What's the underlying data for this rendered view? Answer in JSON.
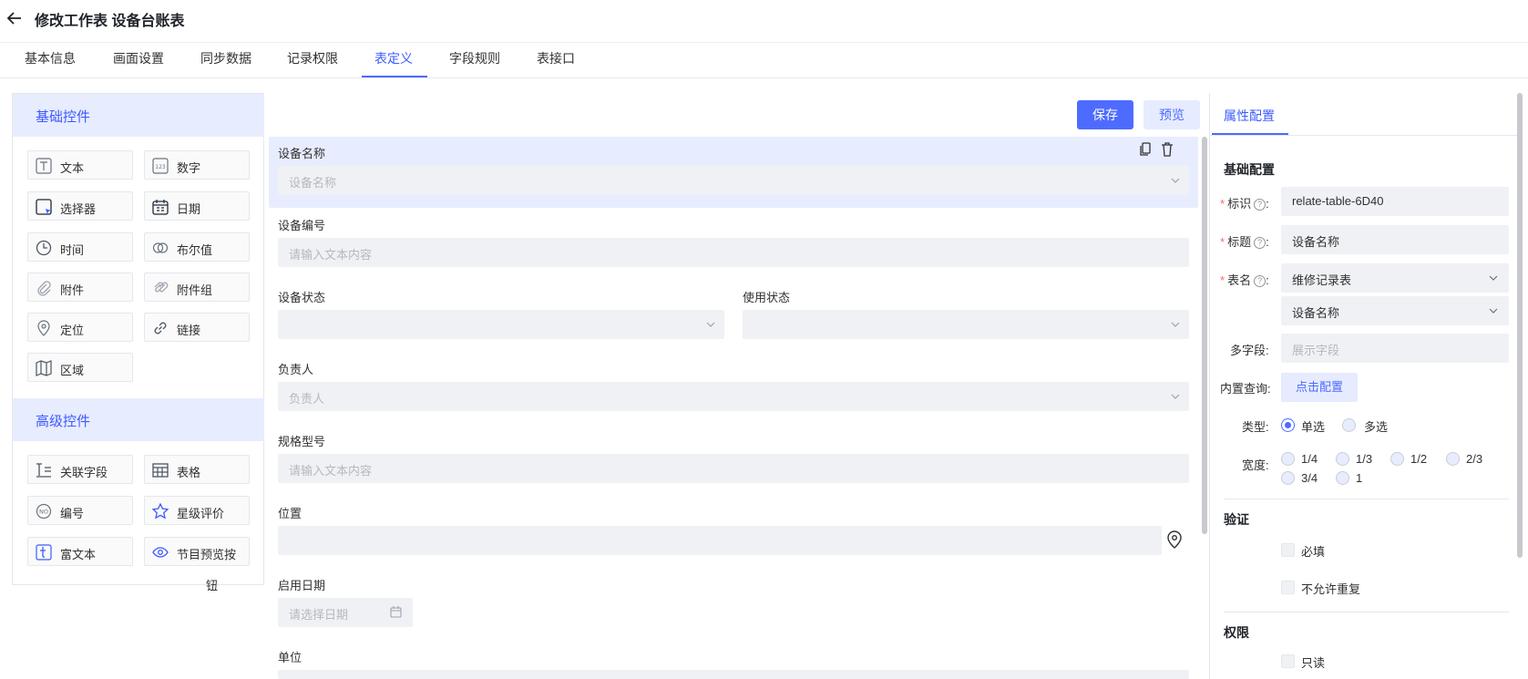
{
  "header": {
    "title": "修改工作表 设备台账表"
  },
  "tabs": [
    "基本信息",
    "画面设置",
    "同步数据",
    "记录权限",
    "表定义",
    "字段规则",
    "表接口"
  ],
  "active_tab": "表定义",
  "left": {
    "basic_title": "基础控件",
    "basic": [
      {
        "label": "文本",
        "icon": "text-icon"
      },
      {
        "label": "数字",
        "icon": "number-icon"
      },
      {
        "label": "选择器",
        "icon": "selector-icon"
      },
      {
        "label": "日期",
        "icon": "calendar-icon"
      },
      {
        "label": "时间",
        "icon": "clock-icon"
      },
      {
        "label": "布尔值",
        "icon": "boolean-icon"
      },
      {
        "label": "附件",
        "icon": "paperclip-icon"
      },
      {
        "label": "附件组",
        "icon": "attachment-group-icon"
      },
      {
        "label": "定位",
        "icon": "location-pin-icon"
      },
      {
        "label": "链接",
        "icon": "link-icon"
      },
      {
        "label": "区域",
        "icon": "map-icon"
      }
    ],
    "advanced_title": "高级控件",
    "advanced": [
      {
        "label": "关联字段",
        "icon": "related-field-icon"
      },
      {
        "label": "表格",
        "icon": "table-icon"
      },
      {
        "label": "编号",
        "icon": "number-badge-icon"
      },
      {
        "label": "星级评价",
        "icon": "star-icon"
      },
      {
        "label": "富文本",
        "icon": "rich-text-icon"
      },
      {
        "label": "节目预览按",
        "icon": "eye-icon"
      }
    ],
    "wrap_tail": "钮"
  },
  "toolbar": {
    "save": "保存",
    "preview": "预览"
  },
  "form": {
    "device_name": {
      "label": "设备名称",
      "placeholder": "设备名称"
    },
    "device_code": {
      "label": "设备编号",
      "placeholder": "请输入文本内容"
    },
    "device_status": {
      "label": "设备状态"
    },
    "usage_status": {
      "label": "使用状态"
    },
    "owner": {
      "label": "负责人",
      "placeholder": "负责人"
    },
    "model": {
      "label": "规格型号",
      "placeholder": "请输入文本内容"
    },
    "location": {
      "label": "位置"
    },
    "start_date": {
      "label": "启用日期",
      "placeholder": "请选择日期"
    },
    "unit": {
      "label": "单位"
    }
  },
  "props": {
    "tab": "属性配置",
    "basic_title": "基础配置",
    "id_label": "标识",
    "id_value": "relate-table-6D40",
    "title_label": "标题",
    "title_value": "设备名称",
    "table_label": "表名",
    "table_value": "维修记录表",
    "table_field_value": "设备名称",
    "multi_label": "多字段:",
    "multi_placeholder": "展示字段",
    "query_label": "内置查询:",
    "query_button": "点击配置",
    "type_label": "类型:",
    "type_options": [
      "单选",
      "多选"
    ],
    "type_selected": "单选",
    "width_label": "宽度:",
    "width_options": [
      "1/4",
      "1/3",
      "1/2",
      "2/3",
      "3/4",
      "1"
    ],
    "validate_title": "验证",
    "required": "必填",
    "no_dup": "不允许重复",
    "perm_title": "权限",
    "readonly": "只读"
  }
}
